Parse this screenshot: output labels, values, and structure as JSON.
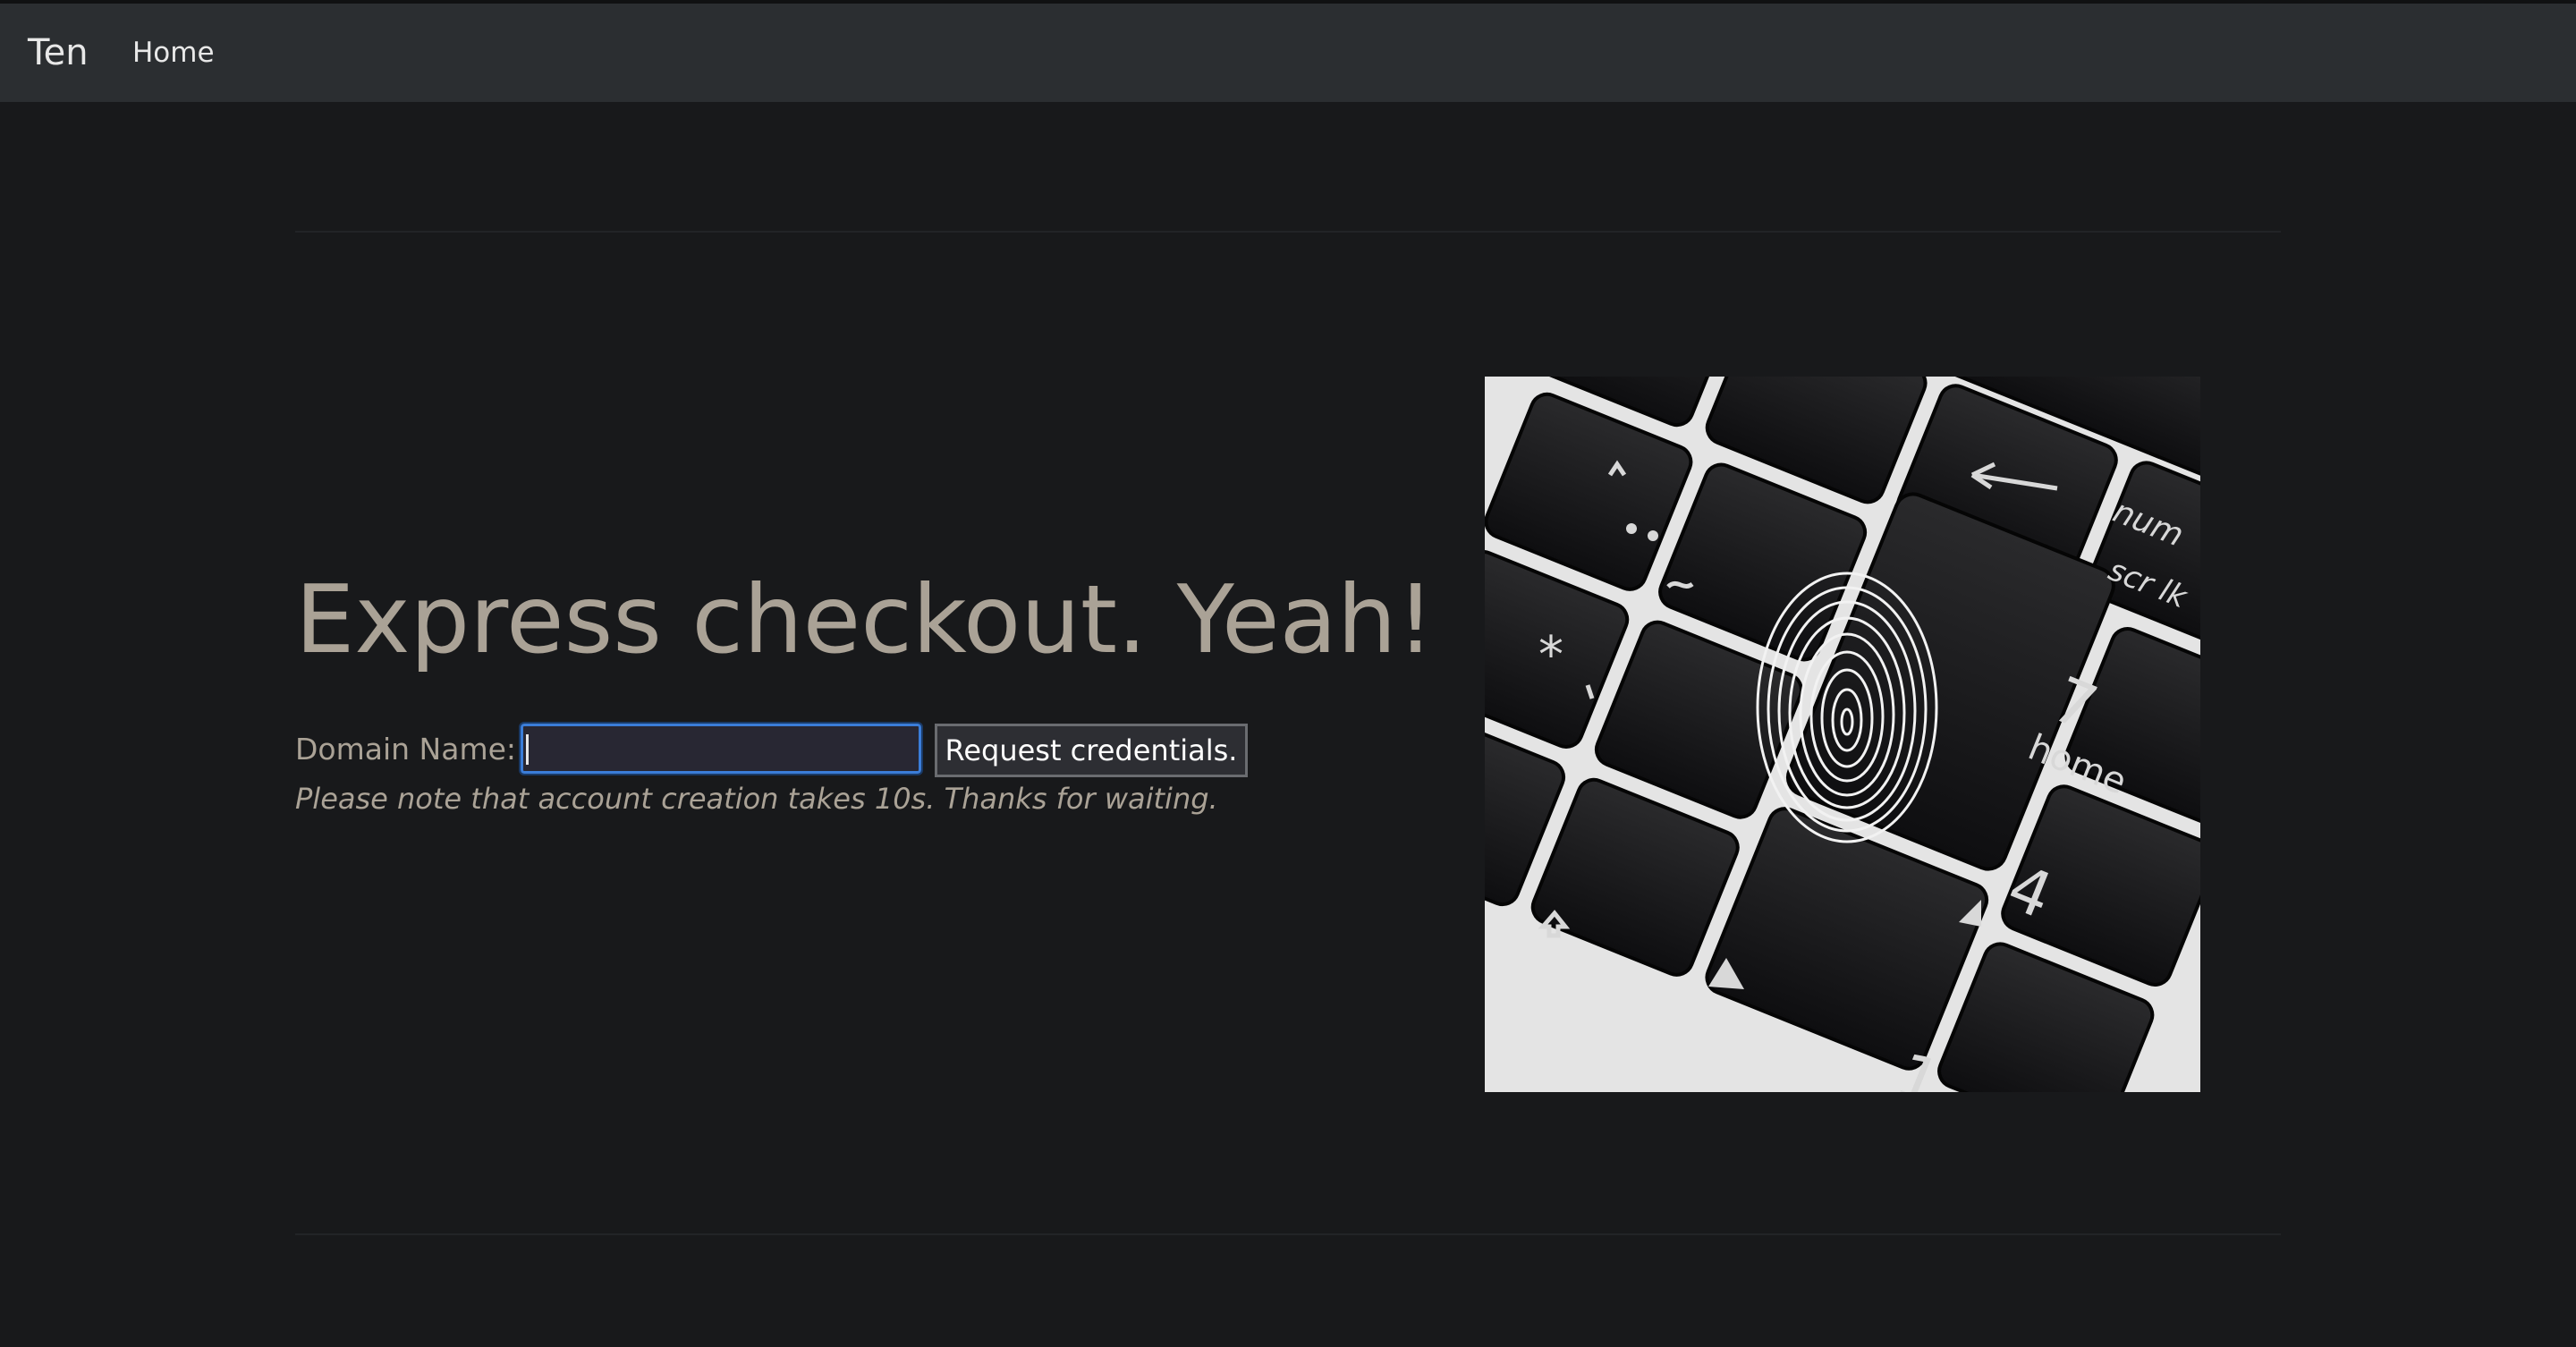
{
  "navbar": {
    "brand": "Ten",
    "links": [
      "Home"
    ]
  },
  "main": {
    "headline": "Express checkout. Yeah!",
    "form": {
      "label": "Domain Name:",
      "input_value": "",
      "button_label": "Request credentials."
    },
    "note": "Please note that account creation takes 10s. Thanks for waiting."
  },
  "image": {
    "key_labels": [
      "num",
      "scr lk",
      "7",
      "home",
      "4",
      "1"
    ]
  },
  "colors": {
    "page_bg": "#18191b",
    "navbar_bg": "#2b2e31",
    "text_muted": "#aaa296",
    "input_focus": "#3b7dd8"
  }
}
